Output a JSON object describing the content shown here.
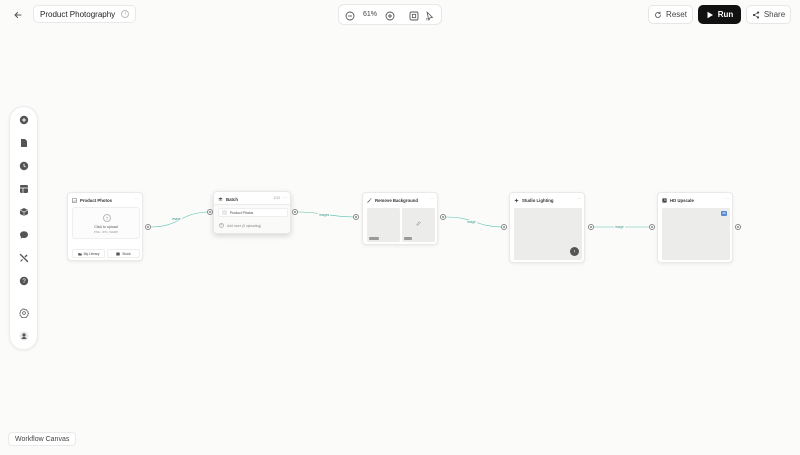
{
  "header": {
    "project_title": "Product Photography",
    "zoom": "61%",
    "reset_label": "Reset",
    "run_label": "Run",
    "share_label": "Share"
  },
  "sidebar": {
    "icons": [
      "add-icon",
      "file-icon",
      "history-icon",
      "template-icon",
      "cube-icon",
      "chat-icon",
      "tools-icon",
      "help-icon",
      "settings-icon",
      "account-icon"
    ]
  },
  "nodes": {
    "product_photos": {
      "title": "Product Photos",
      "upload_title": "Click to upload",
      "upload_hint": "PNG, JPG, WEBP",
      "btn_library": "My Library",
      "btn_stock": "Stock"
    },
    "batch": {
      "title": "Batch",
      "count": "1/10",
      "item": "Product Photos",
      "add_hint": "Add more (if uploading)"
    },
    "remove_background": {
      "title": "Remove Background"
    },
    "studio_lighting": {
      "title": "Studio Lighting"
    },
    "hd_upscale": {
      "title": "HD Upscale",
      "badge": "4K"
    }
  },
  "edges": [
    "image",
    "images",
    "image",
    "image"
  ],
  "footer": {
    "label": "Workflow Canvas"
  },
  "colors": {
    "accent": "#3b9c8c",
    "run_bg": "#111111"
  }
}
